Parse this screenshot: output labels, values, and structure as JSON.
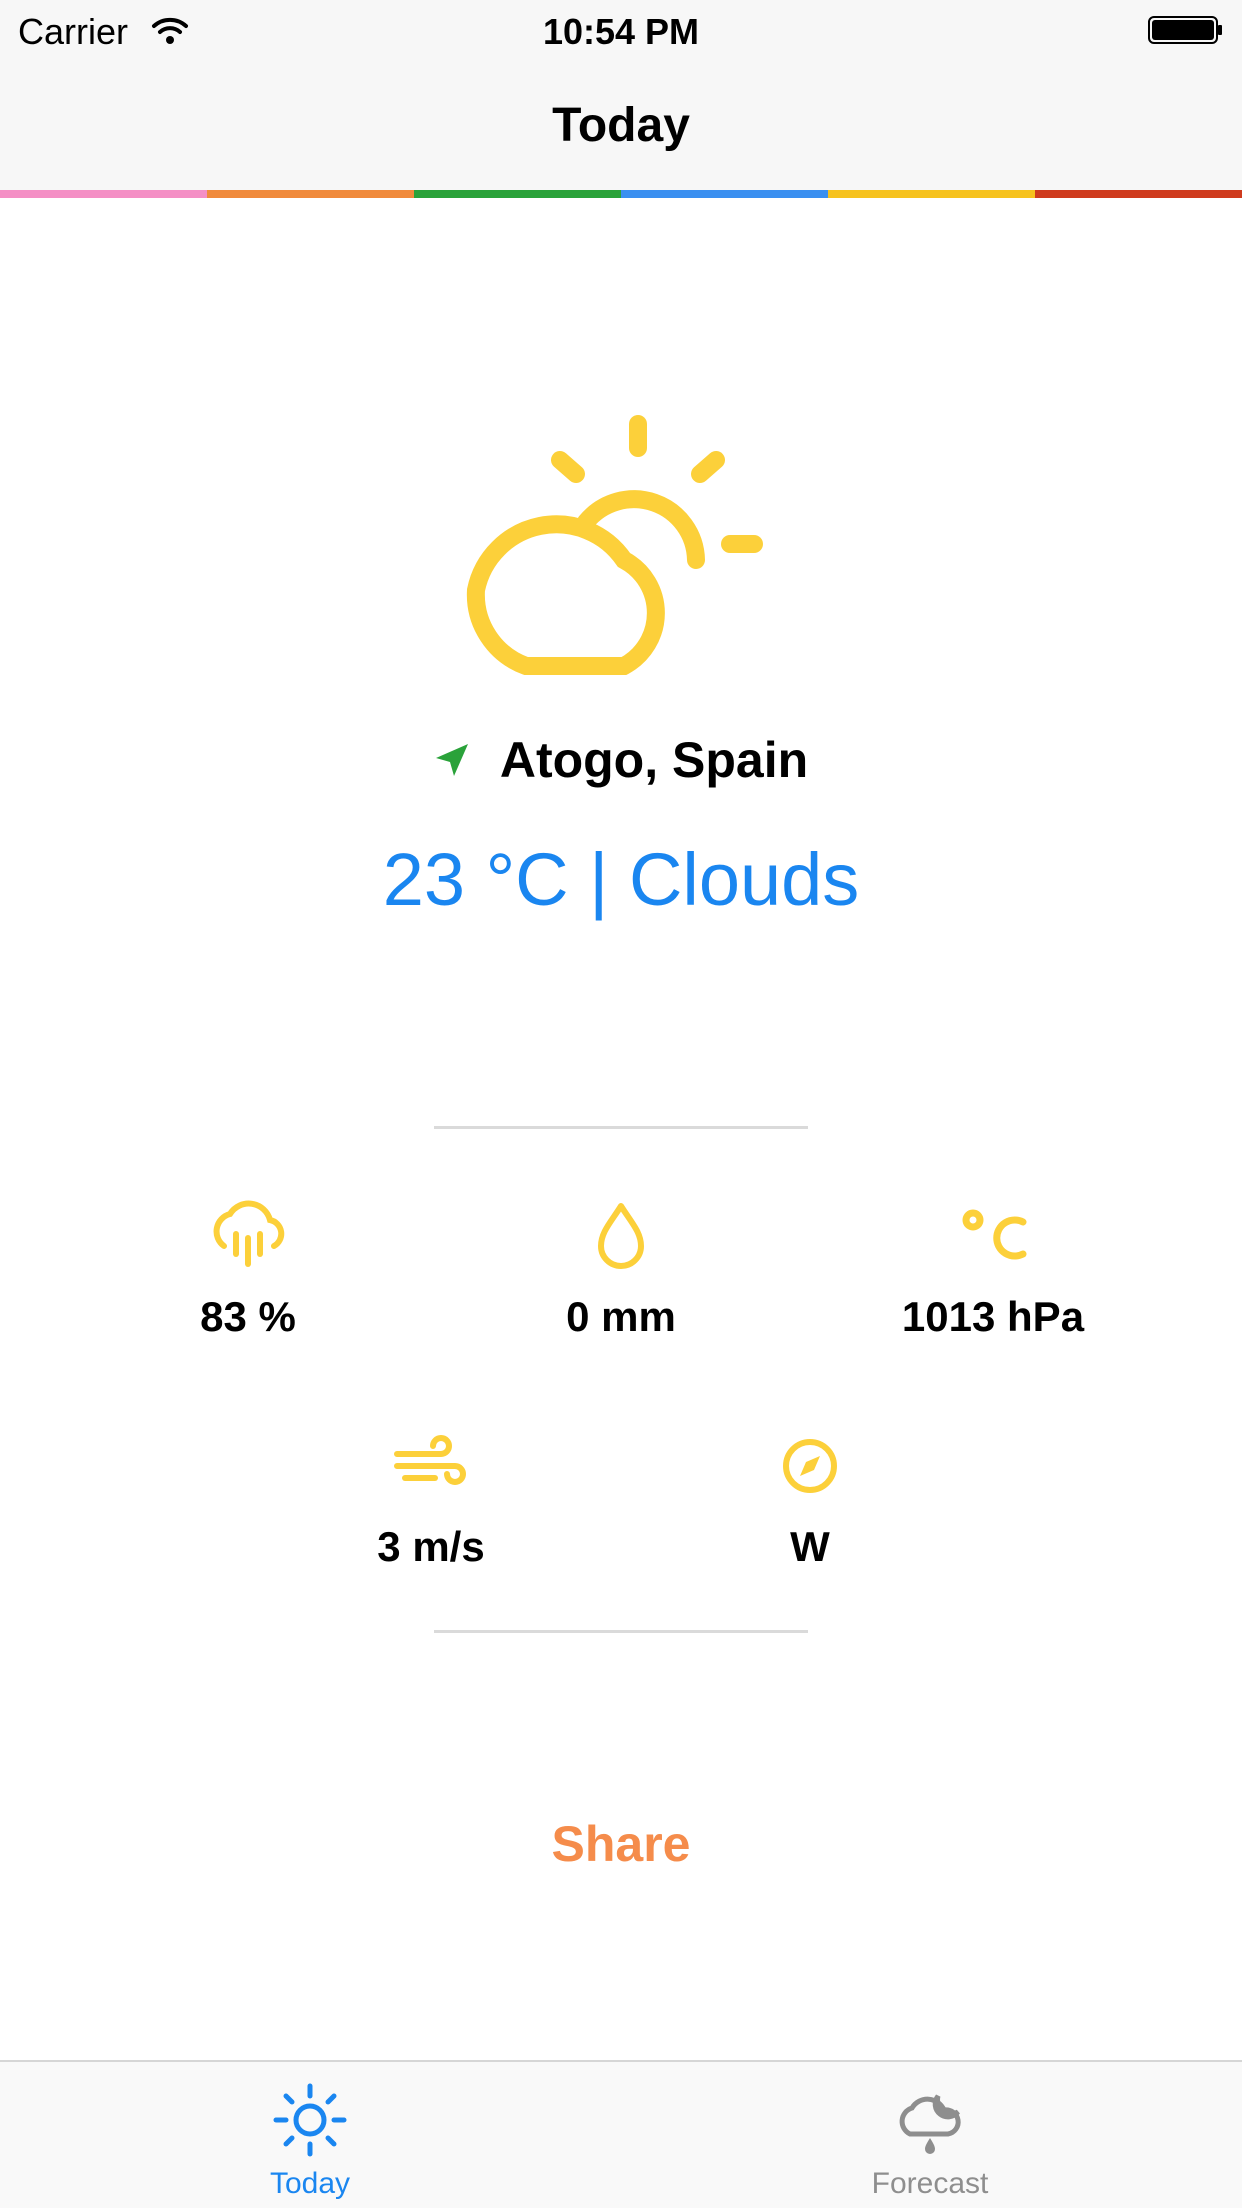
{
  "status_bar": {
    "carrier": "Carrier",
    "time": "10:54 PM"
  },
  "nav": {
    "title": "Today"
  },
  "rainbow_colors": [
    "#f48fc5",
    "#f08a3c",
    "#2aa23a",
    "#3a8ff0",
    "#f6c21e",
    "#cf3b1e"
  ],
  "weather": {
    "icon": "partly-cloudy-icon",
    "location": "Atogo, Spain",
    "summary": "23 °C | Clouds"
  },
  "stats": {
    "humidity": {
      "icon": "rain-cloud-icon",
      "value": "83 %"
    },
    "precipitation": {
      "icon": "drop-icon",
      "value": "0 mm"
    },
    "pressure": {
      "icon": "celsius-icon",
      "value": "1013 hPa"
    },
    "wind_speed": {
      "icon": "wind-icon",
      "value": "3 m/s"
    },
    "wind_direction": {
      "icon": "compass-icon",
      "value": "W"
    }
  },
  "share_label": "Share",
  "tabs": [
    {
      "label": "Today",
      "icon": "sun-icon",
      "active": true
    },
    {
      "label": "Forecast",
      "icon": "cloud-moon-rain-icon",
      "active": false
    }
  ],
  "colors": {
    "accent_blue": "#1a86f0",
    "icon_yellow": "#fcd03a",
    "share_orange": "#f58c4b",
    "inactive_gray": "#8e8e8e"
  }
}
